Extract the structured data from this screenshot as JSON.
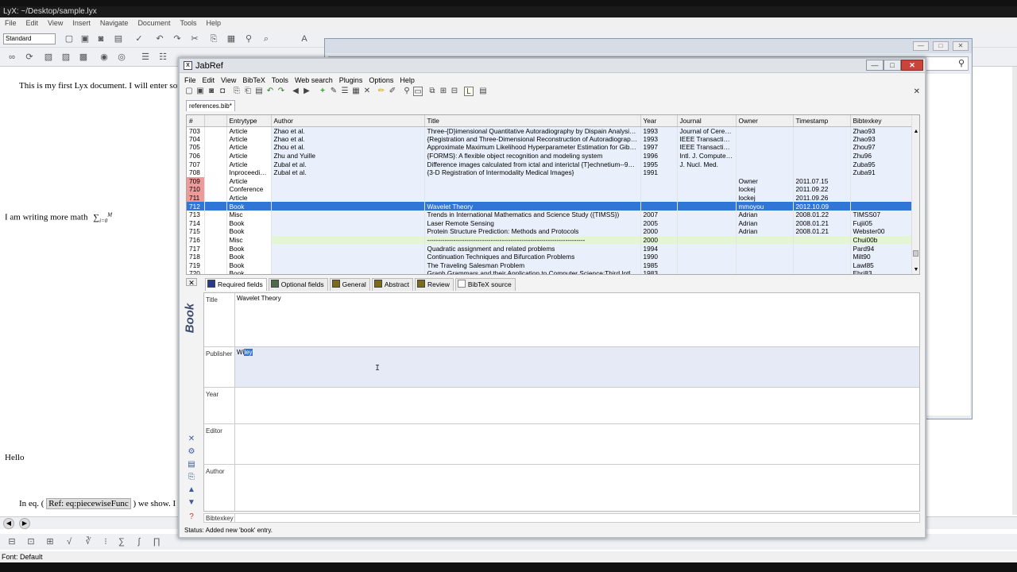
{
  "lyx": {
    "title": "LyX: ~/Desktop/sample.lyx",
    "menu": [
      "File",
      "Edit",
      "View",
      "Insert",
      "Navigate",
      "Document",
      "Tools",
      "Help"
    ],
    "style_select": "Standard",
    "doc_lines": {
      "line1": "This is my first Lyx document. I will enter some m",
      "line2": "I am writing more math",
      "line3": "Hello",
      "line4_pre": "In eq. (",
      "line4_ref": "Ref: eq:piecewiseFunc",
      "line4_post": ") we show. I can re"
    },
    "status": "Font: Default"
  },
  "jabref": {
    "title": "JabRef",
    "menu": [
      "File",
      "Edit",
      "View",
      "BibTeX",
      "Tools",
      "Web search",
      "Plugins",
      "Options",
      "Help"
    ],
    "db_tab": "references.bib*",
    "columns": [
      "#",
      "",
      "Entrytype",
      "Author",
      "Title",
      "Year",
      "Journal",
      "Owner",
      "Timestamp",
      "Bibtexkey"
    ],
    "rows": [
      {
        "n": "703",
        "type": "Article",
        "author": "Zhao et al.",
        "title": "Three-{D}imensional Quantitative Autoradiography by Dispain Analysis...",
        "year": "1993",
        "journal": "Journal of Cereb...",
        "owner": "",
        "ts": "",
        "key": "Zhao93"
      },
      {
        "n": "704",
        "type": "Article",
        "author": "Zhao et al.",
        "title": "{Registration and Three-Dimensional Reconstruction of Autoradiographi...",
        "year": "1993",
        "journal": "IEEE Transaction...",
        "owner": "",
        "ts": "",
        "key": "Zhao93"
      },
      {
        "n": "705",
        "type": "Article",
        "author": "Zhou et al.",
        "title": "Approximate Maximum Likelihood Hyperparameter Estimation for Gibbs ...",
        "year": "1997",
        "journal": "IEEE Transaction...",
        "owner": "",
        "ts": "",
        "key": "Zhou97"
      },
      {
        "n": "706",
        "type": "Article",
        "author": "Zhu and Yuille",
        "title": "{FORMS}: A flexible object recognition and modeling system",
        "year": "1996",
        "journal": "Intl. J. Computer ...",
        "owner": "",
        "ts": "",
        "key": "Zhu96"
      },
      {
        "n": "707",
        "type": "Article",
        "author": "Zubal et al.",
        "title": "Difference images calculated from ictal and interictal {T}echnetium--99m...",
        "year": "1995",
        "journal": "J. Nucl. Med.",
        "owner": "",
        "ts": "",
        "key": "Zuba95"
      },
      {
        "n": "708",
        "type": "Inproceedings",
        "author": "Zubal et al.",
        "title": "{3-D Registration of Intermodality Medical Images}",
        "year": "1991",
        "journal": "",
        "owner": "",
        "ts": "",
        "key": "Zuba91"
      },
      {
        "n": "709",
        "type": "Article",
        "author": "",
        "title": "",
        "year": "",
        "journal": "",
        "owner": "Owner",
        "ts": "2011.07.15",
        "key": "",
        "red": true
      },
      {
        "n": "710",
        "type": "Conference",
        "author": "",
        "title": "",
        "year": "",
        "journal": "",
        "owner": "lockej",
        "ts": "2011.09.22",
        "key": "",
        "red": true
      },
      {
        "n": "711",
        "type": "Article",
        "author": "",
        "title": "",
        "year": "",
        "journal": "",
        "owner": "lockej",
        "ts": "2011.09.26",
        "key": "",
        "red": true
      },
      {
        "n": "712",
        "type": "Book",
        "author": "",
        "title": "Wavelet Theory",
        "year": "",
        "journal": "",
        "owner": "mmoyou",
        "ts": "2012.10.09",
        "key": "",
        "selected": true
      },
      {
        "n": "713",
        "type": "Misc",
        "author": "",
        "title": "Trends in International Mathematics and Science Study ({TIMSS})",
        "year": "2007",
        "journal": "",
        "owner": "Adrian",
        "ts": "2008.01.22",
        "key": "TIMSS07"
      },
      {
        "n": "714",
        "type": "Book",
        "author": "",
        "title": "Laser Remote Sensing",
        "year": "2005",
        "journal": "",
        "owner": "Adrian",
        "ts": "2008.01.21",
        "key": "Fujii05"
      },
      {
        "n": "715",
        "type": "Book",
        "author": "",
        "title": "Protein Structure Prediction: Methods and Protocols",
        "year": "2000",
        "journal": "",
        "owner": "Adrian",
        "ts": "2008.01.21",
        "key": "Webster00"
      },
      {
        "n": "716",
        "type": "Misc",
        "author": "",
        "title": "------------------------------------------------------------------------",
        "year": "2000",
        "journal": "",
        "owner": "",
        "ts": "",
        "key": "Chui00b",
        "green": true
      },
      {
        "n": "717",
        "type": "Book",
        "author": "",
        "title": "Quadratic assignment and related problems",
        "year": "1994",
        "journal": "",
        "owner": "",
        "ts": "",
        "key": "Pard94"
      },
      {
        "n": "718",
        "type": "Book",
        "author": "",
        "title": "Continuation Techniques and Bifurcation Problems",
        "year": "1990",
        "journal": "",
        "owner": "",
        "ts": "",
        "key": "Milt90"
      },
      {
        "n": "719",
        "type": "Book",
        "author": "",
        "title": "The Traveling Salesman Problem",
        "year": "1985",
        "journal": "",
        "owner": "",
        "ts": "",
        "key": "Lawl85"
      },
      {
        "n": "720",
        "type": "Book",
        "author": "",
        "title": "Graph Grammars and their Application to Computer Science;Third Intl. W...",
        "year": "1983",
        "journal": "",
        "owner": "",
        "ts": "",
        "key": "Ehri83"
      }
    ],
    "editor": {
      "entry_type": "Book",
      "tabs": [
        {
          "label": "Required fields",
          "color": "#2a3a8a"
        },
        {
          "label": "Optional fields",
          "color": "#4d6a4d"
        },
        {
          "label": "General",
          "color": "#7a6a1a"
        },
        {
          "label": "Abstract",
          "color": "#7a6a1a"
        },
        {
          "label": "Review",
          "color": "#7a6a1a"
        },
        {
          "label": "BibTeX source",
          "color": "#ffffff"
        }
      ],
      "fields": {
        "title_label": "Title",
        "title_value": "Wavelet Theory",
        "publisher_label": "Publisher",
        "publisher_value_pre": "Wi",
        "publisher_value_sel": "ley",
        "year_label": "Year",
        "editor_label": "Editor",
        "author_label": "Author",
        "bibtexkey_label": "Bibtexkey"
      }
    },
    "status": "Status: Added new 'book' entry."
  }
}
